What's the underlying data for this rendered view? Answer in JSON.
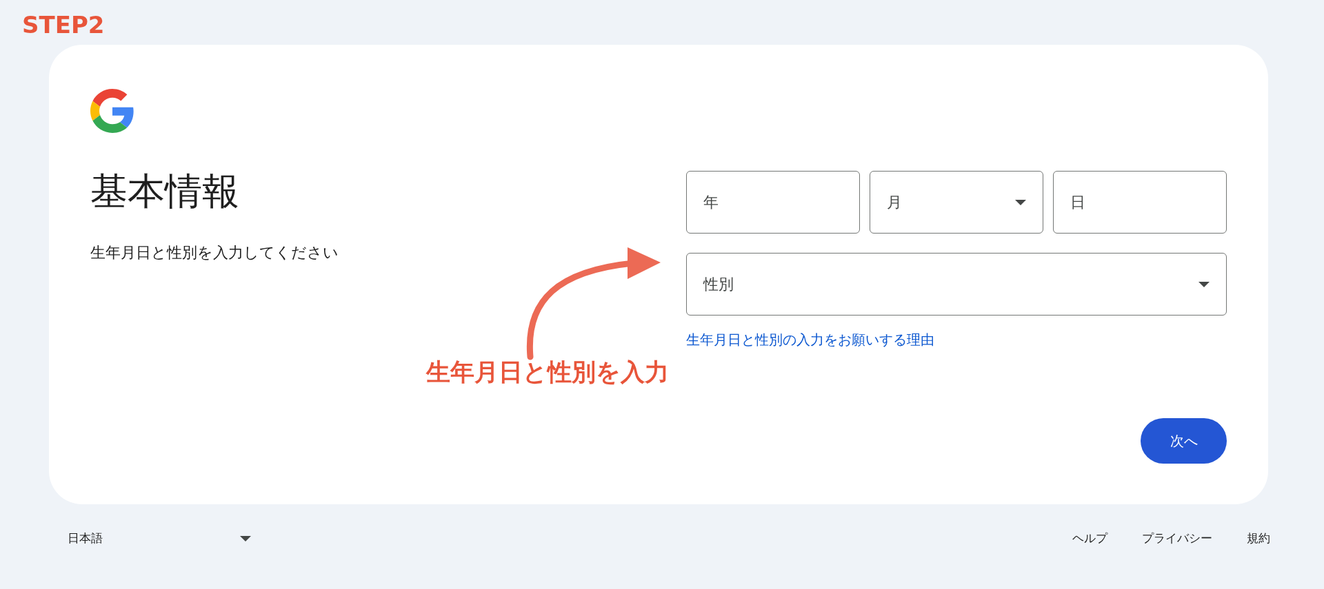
{
  "step_label": "STEP2",
  "card": {
    "title": "基本情報",
    "subtitle": "生年月日と性別を入力してください",
    "birth_fields": [
      {
        "kind": "text",
        "placeholder": "年"
      },
      {
        "kind": "select",
        "label": "月"
      },
      {
        "kind": "text",
        "placeholder": "日"
      }
    ],
    "gender": {
      "kind": "select",
      "label": "性別"
    },
    "link": "生年月日と性別の入力をお願いする理由",
    "next_button": "次へ"
  },
  "callout": {
    "text": "生年月日と性別を入力"
  },
  "footer": {
    "language": "日本語",
    "links": [
      "ヘルプ",
      "プライバシー",
      "規約"
    ]
  }
}
